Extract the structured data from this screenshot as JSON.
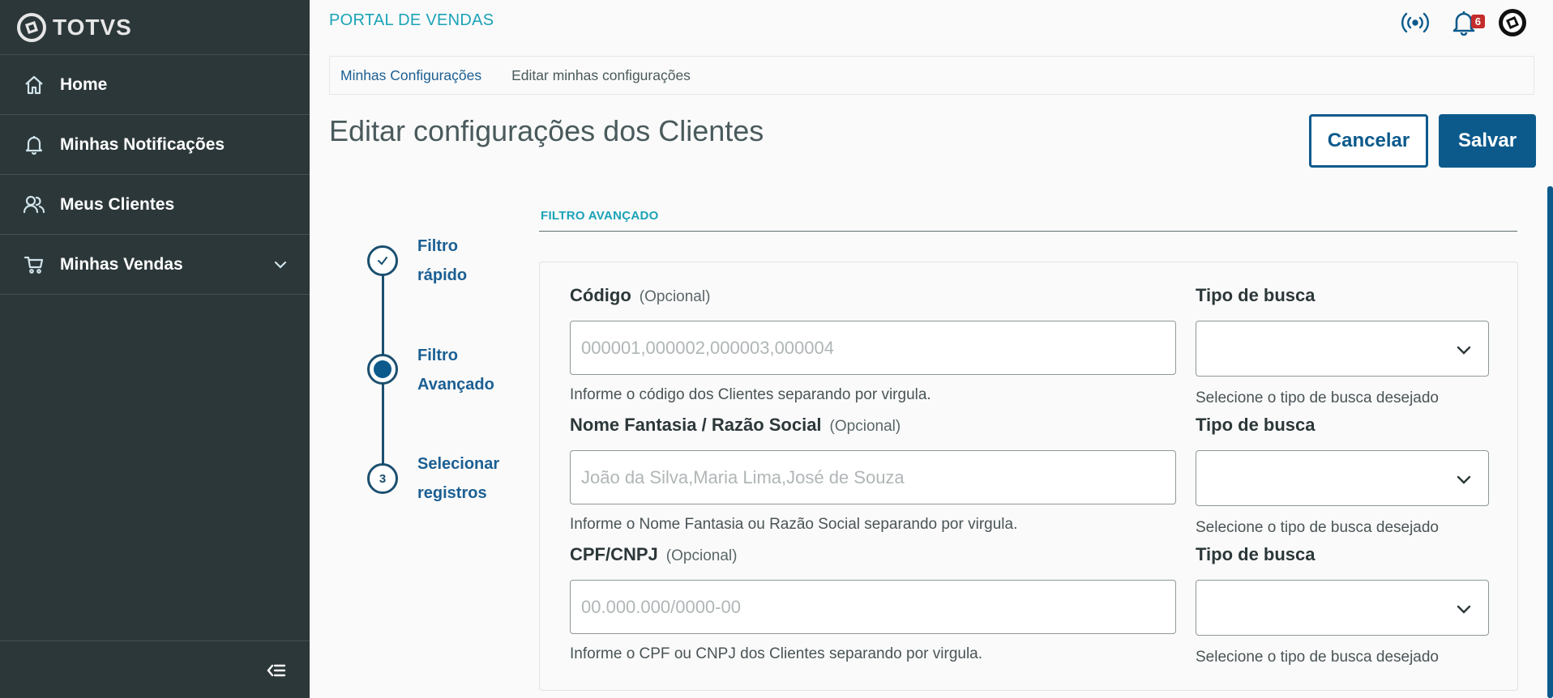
{
  "brand": {
    "name": "TOTVS",
    "logo_icon": "totvs-logo"
  },
  "sidebar": {
    "items": [
      {
        "label": "Home",
        "icon": "home-icon"
      },
      {
        "label": "Minhas Notificações",
        "icon": "bell-icon"
      },
      {
        "label": "Meus Clientes",
        "icon": "users-icon"
      },
      {
        "label": "Minhas Vendas",
        "icon": "cart-icon",
        "expandable": true
      }
    ],
    "collapse_icon": "collapse-menu-icon"
  },
  "header": {
    "title": "PORTAL DE VENDAS",
    "icons": [
      "signal-icon",
      "bell-icon",
      "totvs-logo"
    ],
    "notification_count": "6"
  },
  "breadcrumb": {
    "items": [
      "Minhas Configurações",
      "Editar minhas configurações"
    ]
  },
  "page": {
    "title": "Editar configurações dos Clientes",
    "cancel_label": "Cancelar",
    "save_label": "Salvar"
  },
  "stepper": {
    "steps": [
      {
        "line1": "Filtro",
        "line2": "rápido",
        "state": "done"
      },
      {
        "line1": "Filtro",
        "line2": "Avançado",
        "state": "active"
      },
      {
        "line1": "Selecionar",
        "line2": "registros",
        "state": "pending",
        "number": "3"
      }
    ]
  },
  "section": {
    "title": "FILTRO AVANÇADO"
  },
  "form": {
    "optional_label": "(Opcional)",
    "fields": [
      {
        "label": "Código",
        "placeholder": "000001,000002,000003,000004",
        "help": "Informe o código dos Clientes separando por virgula.",
        "select_label": "Tipo de busca",
        "select_help": "Selecione o tipo de busca desejado",
        "select_value": ""
      },
      {
        "label": "Nome Fantasia / Razão Social",
        "placeholder": "João da Silva,Maria Lima,José de Souza",
        "help": "Informe o Nome Fantasia ou Razão Social separando por virgula.",
        "select_label": "Tipo de busca",
        "select_help": "Selecione o tipo de busca desejado",
        "select_value": ""
      },
      {
        "label": "CPF/CNPJ",
        "placeholder": "00.000.000/0000-00",
        "help": "Informe o CPF ou CNPJ dos Clientes separando por virgula.",
        "select_label": "Tipo de busca",
        "select_help": "Selecione o tipo de busca desejado",
        "select_value": ""
      }
    ]
  },
  "colors": {
    "sidebar_bg": "#2c3739",
    "primary": "#0c5a8c",
    "accent": "#1aa3b7",
    "badge": "#c42b2b"
  }
}
